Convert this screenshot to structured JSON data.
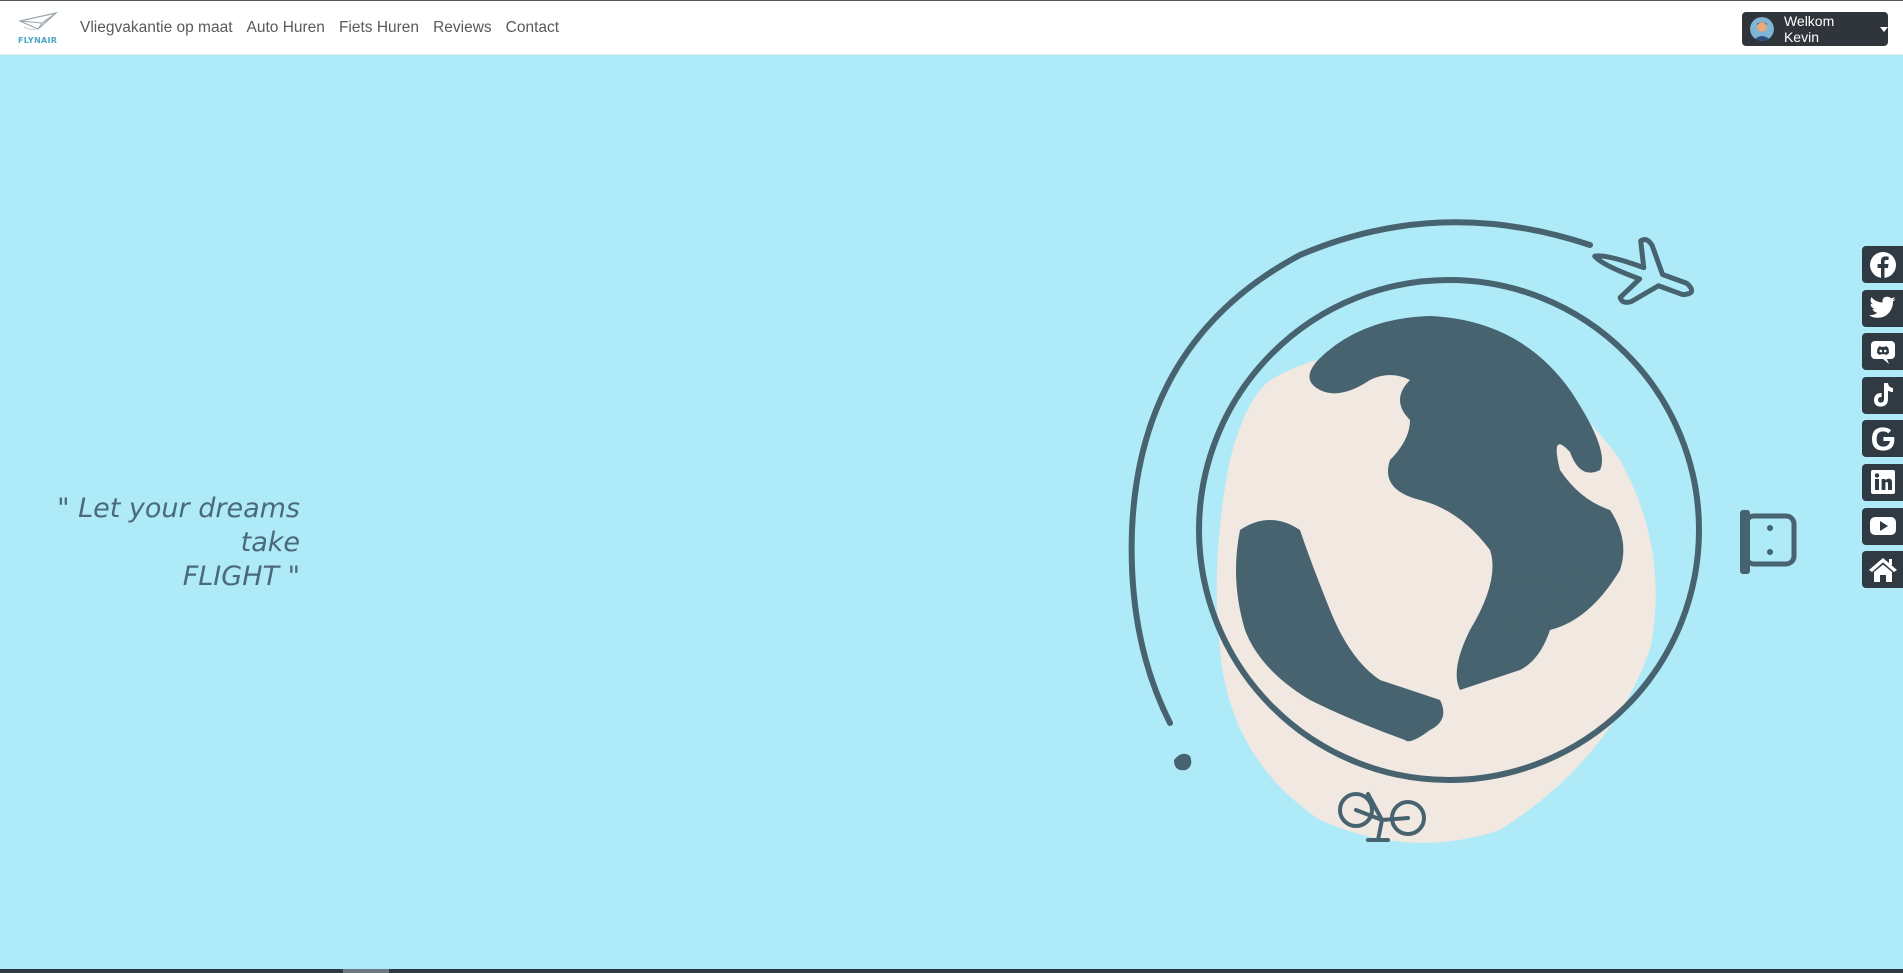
{
  "brand": {
    "logo_text": "FLYNAIR"
  },
  "nav": {
    "links": [
      {
        "label": "Vliegvakantie op maat"
      },
      {
        "label": "Auto Huren"
      },
      {
        "label": "Fiets Huren"
      },
      {
        "label": "Reviews"
      },
      {
        "label": "Contact"
      }
    ]
  },
  "user_menu": {
    "label": "Welkom Kevin"
  },
  "hero": {
    "tagline_line1": "\" Let your dreams take",
    "tagline_line2": "FLIGHT \""
  },
  "social": [
    {
      "icon": "facebook-icon"
    },
    {
      "icon": "twitter-icon"
    },
    {
      "icon": "discord-icon"
    },
    {
      "icon": "tiktok-icon"
    },
    {
      "icon": "google-icon"
    },
    {
      "icon": "linkedin-icon"
    },
    {
      "icon": "youtube-icon"
    },
    {
      "icon": "home-icon"
    }
  ],
  "colors": {
    "background": "#aeeaf8",
    "accent_dark": "#46636f",
    "globe_blob": "#f1e8e2",
    "button_dark": "#2f353b"
  }
}
